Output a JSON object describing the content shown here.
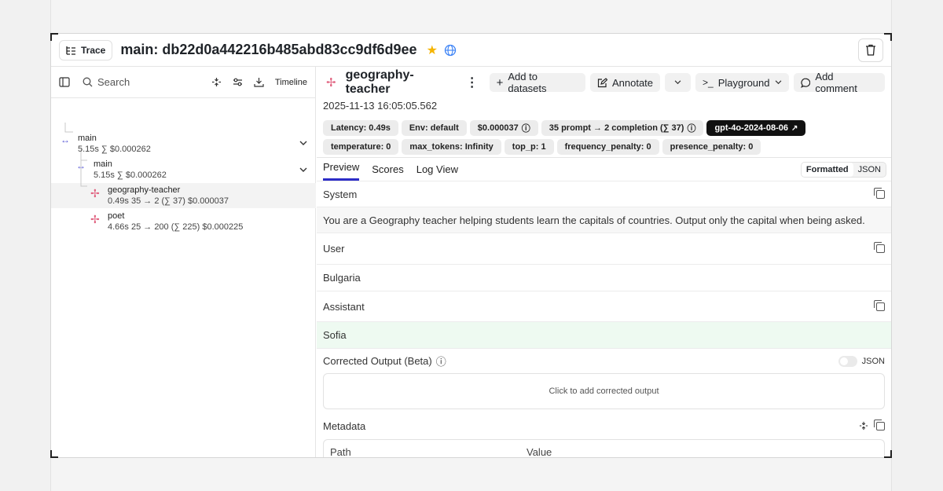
{
  "header": {
    "trace_badge": "Trace",
    "title": "main: db22d0a442216b485abd83cc9df6d9ee"
  },
  "left": {
    "search_placeholder": "Search",
    "timeline_label": "Timeline",
    "tree": [
      {
        "name": "main",
        "meta": "5.15s  ∑ $0.000262"
      },
      {
        "name": "main",
        "meta": "5.15s  ∑ $0.000262"
      },
      {
        "name": "geography-teacher",
        "meta": "0.49s  35 → 2 (∑ 37)  $0.000037"
      },
      {
        "name": "poet",
        "meta": "4.66s  25 → 200 (∑ 225)  $0.000225"
      }
    ]
  },
  "right": {
    "obs_name": "geography-teacher",
    "buttons": {
      "add_datasets": "Add to datasets",
      "annotate": "Annotate",
      "playground": "Playground",
      "add_comment": "Add comment"
    },
    "timestamp": "2025-11-13 16:05:05.562",
    "chips": [
      "Latency: 0.49s",
      "Env: default",
      "$0.000037",
      "35 prompt → 2 completion (∑ 37)",
      "gpt-4o-2024-08-06",
      "temperature: 0",
      "max_tokens: Infinity",
      "top_p: 1",
      "frequency_penalty: 0",
      "presence_penalty: 0"
    ],
    "tabs": [
      "Preview",
      "Scores",
      "Log View"
    ],
    "format_toggle": {
      "formatted": "Formatted",
      "json": "JSON"
    },
    "system": {
      "label": "System",
      "text": "You are a Geography teacher helping students learn the capitals of countries. Output only the capital when being asked."
    },
    "user": {
      "label": "User",
      "text": "Bulgaria"
    },
    "assistant": {
      "label": "Assistant",
      "text": "Sofia"
    },
    "corrected": {
      "label": "Corrected Output (Beta)",
      "json_label": "JSON",
      "placeholder": "Click to add corrected output"
    },
    "metadata": {
      "label": "Metadata",
      "columns": [
        "Path",
        "Value"
      ]
    }
  },
  "colors": {
    "accent_tab": "#2d2dc7",
    "star": "#f5b400",
    "assistant_bg": "#eefaf1",
    "span_icon": "#e0607e",
    "trace_icon": "#5b5bd6"
  }
}
